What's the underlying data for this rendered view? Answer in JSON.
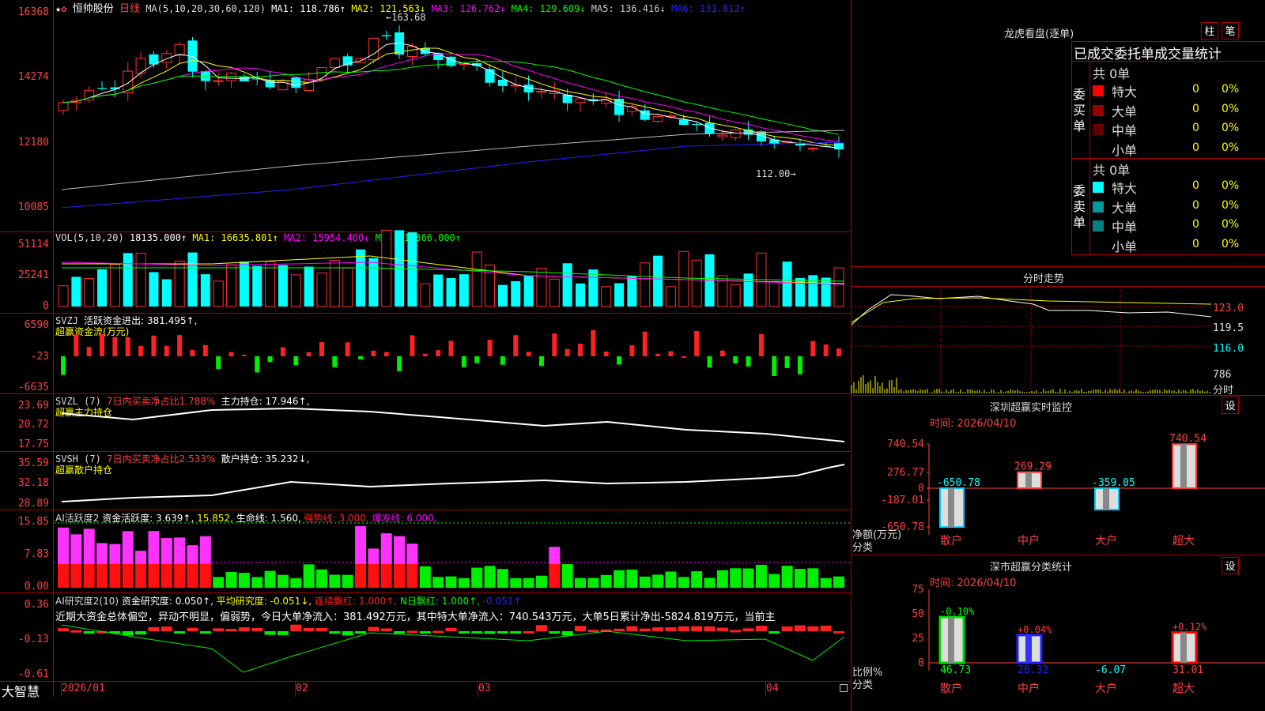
{
  "header": {
    "stock_name": "恒帅股份",
    "period": "日线",
    "ma_label": "MA(5,10,20,30,60,120)",
    "ma1": "MA1: 118.786↑",
    "ma2": "MA2: 121.563↓",
    "ma3": "MA3: 126.762↓",
    "ma4": "MA4: 129.609↓",
    "ma5": "MA5: 136.416↓",
    "ma6": "MA6: 131.812↑"
  },
  "price_axis": [
    "16368",
    "14274",
    "12180",
    "10085"
  ],
  "price_annotations": {
    "high": "163.68",
    "low": "112.00"
  },
  "vol": {
    "label": "VOL(5,10,20)",
    "value": "18135.000↑",
    "ma1": "MA1: 16635.801↑",
    "ma2": "MA2: 15954.400↓",
    "ma3": "MA3: 17866.000↑",
    "axis": [
      "51114",
      "25241",
      "0"
    ]
  },
  "svzj": {
    "name": "SVZJ",
    "line1": "活跃资金进出: 381.495↑,",
    "line2": "超赢资金流(万元)",
    "axis": [
      "6590",
      "-23",
      "-6635"
    ]
  },
  "svzl": {
    "name": "SVZL (7)",
    "text1": "7日内买卖净占比1.788%",
    "text2": "主力持仓: 17.946↑,",
    "line2": "超赢主力持仓",
    "axis": [
      "23.69",
      "20.72",
      "17.75"
    ]
  },
  "svsh": {
    "name": "SVSH (7)",
    "text1": "7日内买卖净占比2.533%",
    "text2": "散户持仓: 35.232↓,",
    "line2": "超赢散户持仓",
    "axis": [
      "35.59",
      "32.18",
      "28.89"
    ]
  },
  "ai_active": {
    "name": "AI活跃度2",
    "t1": "资金活跃度: 3.639↑,",
    "t2": "15.852,",
    "t3": "生命线: 1.560,",
    "t4": "强势线: 3.000,",
    "t5": "爆发线: 6.000,",
    "axis": [
      "15.85",
      "7.83",
      "0.00"
    ]
  },
  "ai_research": {
    "name": "AI研究度2(10)",
    "t1": "资金研究度: 0.050↑,",
    "t2": "平均研究度: -0.051↓,",
    "t3": "连续飘红: 1.000↑,",
    "t4": "N日飘红: 1.000↑,",
    "t5": "-0.051↑",
    "summary": "近期大资金总体偏空，异动不明显，偏弱势，今日大单净流入：381.492万元，其中特大单净流入：740.543万元，大单5日累计净出-5824.819万元，当前主",
    "axis": [
      "0.36",
      "-0.13",
      "-0.61"
    ]
  },
  "x_axis": [
    "2026/01",
    "02",
    "03",
    "04"
  ],
  "logo": "大智慧",
  "dragon": {
    "title": "龙虎看盘(逐单)",
    "btn1": "柱",
    "btn2": "笔",
    "subtitle": "已成交委托单成交量统计",
    "buy_label": "委买单",
    "sell_label": "委卖单",
    "buy_total": "共 0单",
    "sell_total": "共 0单",
    "buy_rows": [
      {
        "name": "特大",
        "count": "0",
        "pct": "0%",
        "color": "#ff0000"
      },
      {
        "name": "大单",
        "count": "0",
        "pct": "0%",
        "color": "#990000"
      },
      {
        "name": "中单",
        "count": "0",
        "pct": "0%",
        "color": "#660000"
      },
      {
        "name": "小单",
        "count": "0",
        "pct": "0%",
        "color": "#000000"
      }
    ],
    "sell_rows": [
      {
        "name": "特大",
        "count": "0",
        "pct": "0%",
        "color": "#00ffff"
      },
      {
        "name": "大单",
        "count": "0",
        "pct": "0%",
        "color": "#009999"
      },
      {
        "name": "中单",
        "count": "0",
        "pct": "0%",
        "color": "#008080"
      },
      {
        "name": "小单",
        "count": "0",
        "pct": "0%",
        "color": "#000000"
      }
    ]
  },
  "intraday": {
    "title": "分时走势",
    "axis": [
      "123.0",
      "119.5",
      "116.0",
      "786"
    ],
    "unit": "分时"
  },
  "sz_monitor": {
    "title": "深圳超赢实时监控",
    "btn": "设",
    "date": "时间: 2026/04/10",
    "axis": [
      "740.54",
      "276.77",
      "0",
      "-187.01",
      "-650.78"
    ],
    "y_label_1": "净额(万元)",
    "y_label_2": "分类",
    "categories": [
      "散户",
      "中户",
      "大户",
      "超大"
    ],
    "values": [
      -650.78,
      269.29,
      -359.05,
      740.54
    ],
    "value_labels": [
      "-650.78",
      "269.29",
      "-359.05",
      "740.54"
    ]
  },
  "sz_stats": {
    "title": "深市超赢分类统计",
    "btn": "设",
    "date": "时间: 2026/04/10",
    "axis": [
      "75",
      "50",
      "25",
      "0"
    ],
    "y_label_1": "比例%",
    "y_label_2": "分类",
    "categories": [
      "散户",
      "中户",
      "大户",
      "超大"
    ],
    "values": [
      46.73,
      28.32,
      -6.07,
      31.01
    ],
    "value_labels": [
      "46.73",
      "28.32",
      "-6.07",
      "31.01"
    ],
    "changes": [
      "-0.10%",
      "+0.04%",
      "",
      "+0.12%"
    ],
    "colors": [
      "#00dd00",
      "#2222ff",
      "#00ffff",
      "#ff0000"
    ]
  }
}
